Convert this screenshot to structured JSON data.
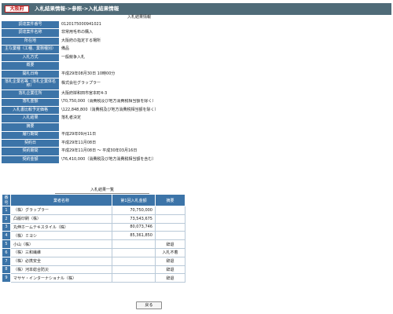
{
  "header": {
    "prefecture": "大阪府",
    "breadcrumb": "入札結果情報->参照->入札結果情報"
  },
  "info_section_title": "入札結果情報",
  "info_rows": [
    {
      "label": "調達案件番号",
      "value": "0120175000941021"
    },
    {
      "label": "調達案件名称",
      "value": "非常用毛布の購入"
    },
    {
      "label": "所在地",
      "value": "大阪府の指定する場所"
    },
    {
      "label": "主な業種（工種、業務種別）",
      "value": "備品"
    },
    {
      "label": "入札方式",
      "value": "一般競争入札"
    },
    {
      "label": "概要",
      "value": ""
    },
    {
      "label": "開札日時",
      "value": "平成29年08月30日 10時00分"
    },
    {
      "label": "落札企業名等（落札企業体名称）",
      "value": "株式会社グラップラー"
    },
    {
      "label": "落札企業住所",
      "value": "大阪府岸和田市宮本町4-3"
    },
    {
      "label": "落札金額",
      "value": "\\70,750,000（消費税及び地方消費税相当額を除く）"
    },
    {
      "label": "入札書比較予定価格",
      "value": "\\122,848,800（消費税及び地方消費税相当額を除く）"
    },
    {
      "label": "入札結果",
      "value": "落札者決定"
    },
    {
      "label": "摘要",
      "value": ""
    },
    {
      "label": "履行期間",
      "value": "平成29年09月11日"
    },
    {
      "label": "契約日",
      "value": "平成29年11月08日"
    },
    {
      "label": "契約期間",
      "value": "平成29年11月08日 ～ 平成30年03月16日"
    },
    {
      "label": "契約金額",
      "value": "\\76,410,000（消費税及び地方消費税相当額を含む）"
    }
  ],
  "results_section_title": "入札結果一覧",
  "results_table": {
    "headers": [
      "番号",
      "業者名称",
      "第1回入札金額",
      "摘要"
    ],
    "rows": [
      {
        "no": "1",
        "name": "（株）グラップラー",
        "amount": "70,750,000",
        "summary": ""
      },
      {
        "no": "2",
        "name": "凸版印刷（株）",
        "amount": "73,543,675",
        "summary": ""
      },
      {
        "no": "3",
        "name": "丸伸ホームテキスタイル（株）",
        "amount": "80,073,746",
        "summary": ""
      },
      {
        "no": "4",
        "name": "（株）ミヨシ",
        "amount": "85,361,850",
        "summary": ""
      },
      {
        "no": "5",
        "name": "小山（株）",
        "amount": "",
        "summary": "辞退"
      },
      {
        "no": "6",
        "name": "（株）三和繊維",
        "amount": "",
        "summary": "入札不着"
      },
      {
        "no": "7",
        "name": "（株）必携安全",
        "amount": "",
        "summary": "辞退"
      },
      {
        "no": "8",
        "name": "（株）河本総合防災",
        "amount": "",
        "summary": "辞退"
      },
      {
        "no": "9",
        "name": "マサヤ・インターナショナル（株）",
        "amount": "",
        "summary": "辞退"
      }
    ]
  },
  "back_button": "戻る",
  "colors": {
    "header_bar": "#4f6b78",
    "label_cell": "#3c74a8",
    "prefecture_border": "#c21f1f"
  }
}
